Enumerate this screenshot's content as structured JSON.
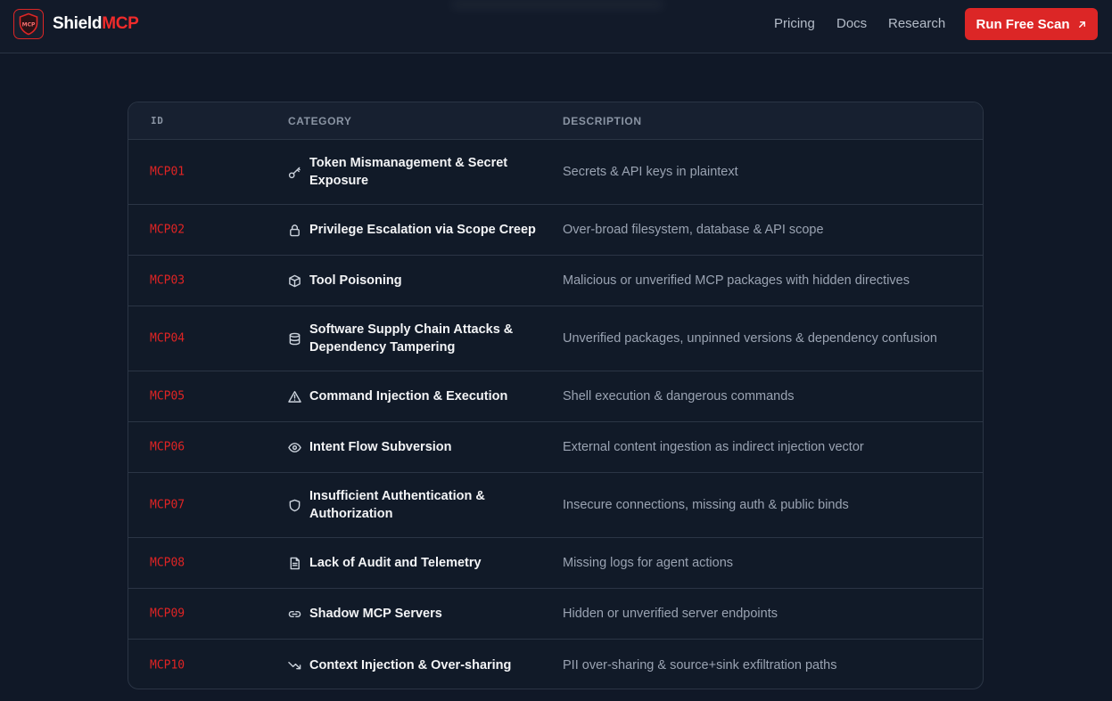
{
  "brand": {
    "name_white": "Shield",
    "name_red": "MCP",
    "logo_text": "MCP"
  },
  "nav": {
    "pricing": "Pricing",
    "docs": "Docs",
    "research": "Research"
  },
  "cta": {
    "label": "Run Free Scan",
    "icon": "arrow-up-right-icon"
  },
  "table": {
    "headers": {
      "id": "ID",
      "category": "CATEGORY",
      "description": "DESCRIPTION"
    },
    "rows": [
      {
        "id": "MCP01",
        "icon": "key-icon",
        "category": "Token Mismanagement & Secret Exposure",
        "description": "Secrets & API keys in plaintext"
      },
      {
        "id": "MCP02",
        "icon": "lock-icon",
        "category": "Privilege Escalation via Scope Creep",
        "description": "Over-broad filesystem, database & API scope"
      },
      {
        "id": "MCP03",
        "icon": "package-icon",
        "category": "Tool Poisoning",
        "description": "Malicious or unverified MCP packages with hidden directives"
      },
      {
        "id": "MCP04",
        "icon": "database-icon",
        "category": "Software Supply Chain Attacks & Dependency Tampering",
        "description": "Unverified packages, unpinned versions & dependency confusion"
      },
      {
        "id": "MCP05",
        "icon": "warning-icon",
        "category": "Command Injection & Execution",
        "description": "Shell execution & dangerous commands"
      },
      {
        "id": "MCP06",
        "icon": "eye-icon",
        "category": "Intent Flow Subversion",
        "description": "External content ingestion as indirect injection vector"
      },
      {
        "id": "MCP07",
        "icon": "shield-icon",
        "category": "Insufficient Authentication & Authorization",
        "description": "Insecure connections, missing auth & public binds"
      },
      {
        "id": "MCP08",
        "icon": "file-icon",
        "category": "Lack of Audit and Telemetry",
        "description": "Missing logs for agent actions"
      },
      {
        "id": "MCP09",
        "icon": "link-icon",
        "category": "Shadow MCP Servers",
        "description": "Hidden or unverified server endpoints"
      },
      {
        "id": "MCP10",
        "icon": "trend-down-icon",
        "category": "Context Injection & Over-sharing",
        "description": "PII over-sharing & source+sink exfiltration paths"
      }
    ]
  },
  "colors": {
    "accent": "#dc2626",
    "background": "#101827",
    "id_text": "#e02424"
  }
}
